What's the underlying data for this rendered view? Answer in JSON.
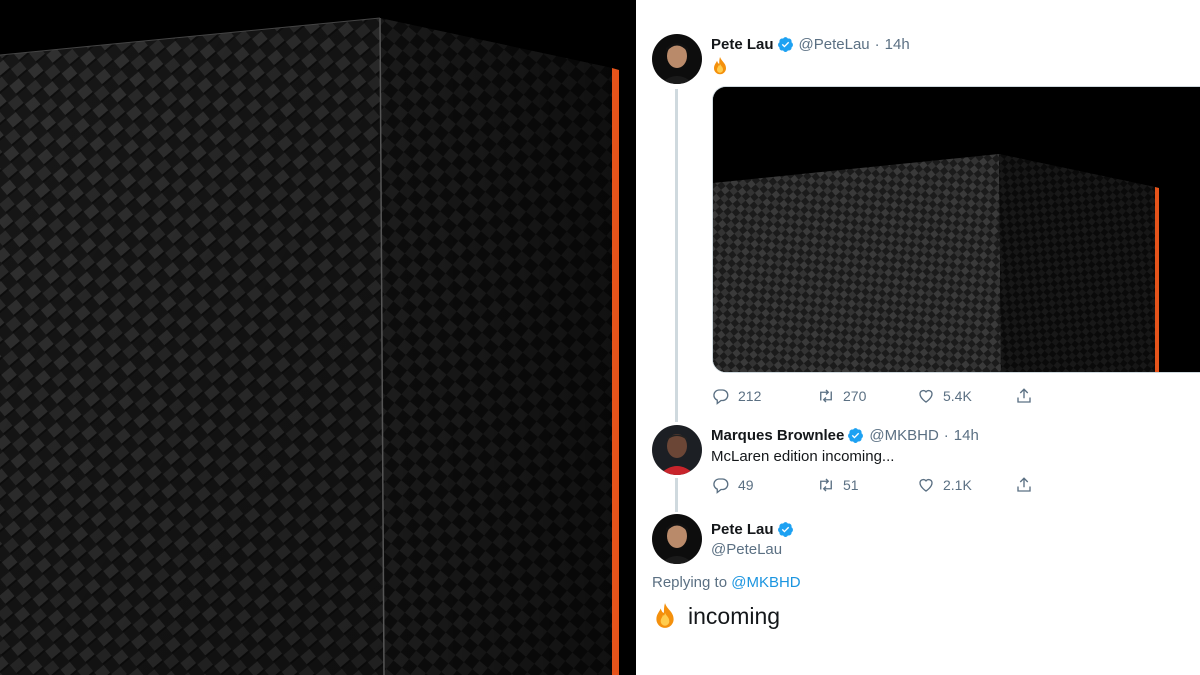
{
  "colors": {
    "accent": "#1da1f2",
    "mention": "#1b95e0",
    "secondary_text": "#5b7083",
    "orange_trim": "#e5531a",
    "thread_line": "#cfd9de"
  },
  "hero_image": {
    "subject": "carbon-fiber-box"
  },
  "tweets": [
    {
      "name": "Pete Lau",
      "verified": true,
      "handle": "@PeteLau",
      "separator": "·",
      "time": "14h",
      "text_icon": "fire-emoji",
      "has_media": true,
      "replies": "212",
      "retweets": "270",
      "likes": "5.4K"
    },
    {
      "name": "Marques Brownlee",
      "verified": true,
      "handle": "@MKBHD",
      "separator": "·",
      "time": "14h",
      "text": "McLaren edition incoming...",
      "replies": "49",
      "retweets": "51",
      "likes": "2.1K"
    },
    {
      "name": "Pete Lau",
      "verified": true,
      "handle": "@PeteLau",
      "replying_label": "Replying to",
      "replying_to": "@MKBHD",
      "text_icon": "fire-emoji",
      "text": "incoming"
    }
  ]
}
